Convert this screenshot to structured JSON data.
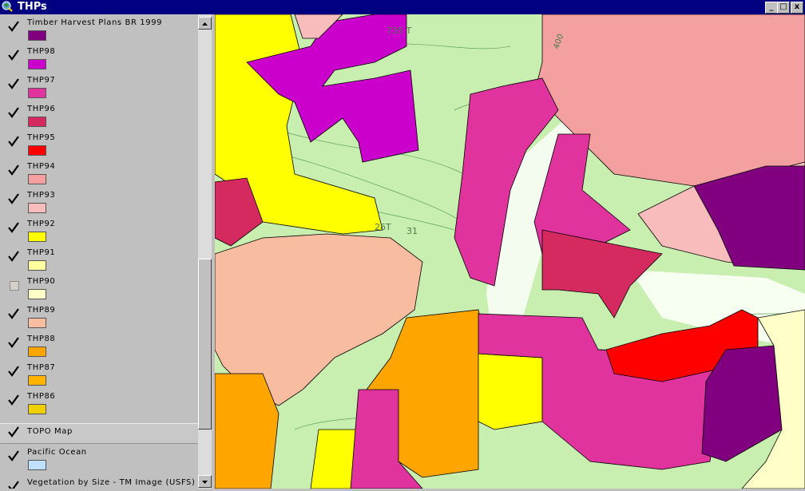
{
  "window": {
    "title": "THPs",
    "minimize_glyph": "_",
    "maximize_glyph": "□",
    "close_glyph": "x"
  },
  "layers": [
    {
      "label": "Timber Harvest Plans BR 1999",
      "checked": true,
      "swatch": "#800080"
    },
    {
      "label": "THP98",
      "checked": true,
      "swatch": "#cc00cc"
    },
    {
      "label": "THP97",
      "checked": true,
      "swatch": "#e0339e"
    },
    {
      "label": "THP96",
      "checked": true,
      "swatch": "#d42a5f"
    },
    {
      "label": "THP95",
      "checked": true,
      "swatch": "#ff0000"
    },
    {
      "label": "THP94",
      "checked": true,
      "swatch": "#f4a0a0"
    },
    {
      "label": "THP93",
      "checked": true,
      "swatch": "#f8bcbc"
    },
    {
      "label": "THP92",
      "checked": true,
      "swatch": "#ffff00"
    },
    {
      "label": "THP91",
      "checked": true,
      "swatch": "#ffffa0"
    },
    {
      "label": "THP90",
      "checked": false,
      "swatch": "#ffffc8"
    },
    {
      "label": "THP89",
      "checked": true,
      "swatch": "#f8bca0"
    },
    {
      "label": "THP88",
      "checked": true,
      "swatch": "#ffa500"
    },
    {
      "label": "THP87",
      "checked": true,
      "swatch": "#ffb400"
    },
    {
      "label": "THP86",
      "checked": true,
      "swatch": "#f0d000"
    },
    {
      "label": "TOPO Map",
      "checked": true,
      "swatch": null
    },
    {
      "label": "Pacific Ocean",
      "checked": true,
      "swatch": "#c0e0ff"
    },
    {
      "label": "Vegetation by Size - TM Image (USFS)",
      "checked": true,
      "swatch": null
    }
  ],
  "map": {
    "topo_labels": [
      "735 T",
      "26T",
      "31",
      "400"
    ],
    "colors": {
      "topo_green": "#c8eeb0",
      "light_green": "#e2f6cf",
      "purple": "#800080",
      "magenta": "#cc00cc",
      "pink": "#e0339e",
      "crimson": "#d42a5f",
      "red": "#ff0000",
      "salmon": "#f4a0a0",
      "light_pink": "#f8bcbc",
      "peach": "#f8bca0",
      "yellow": "#ffff00",
      "orange": "#ffa500",
      "cream": "#ffffc8"
    }
  }
}
